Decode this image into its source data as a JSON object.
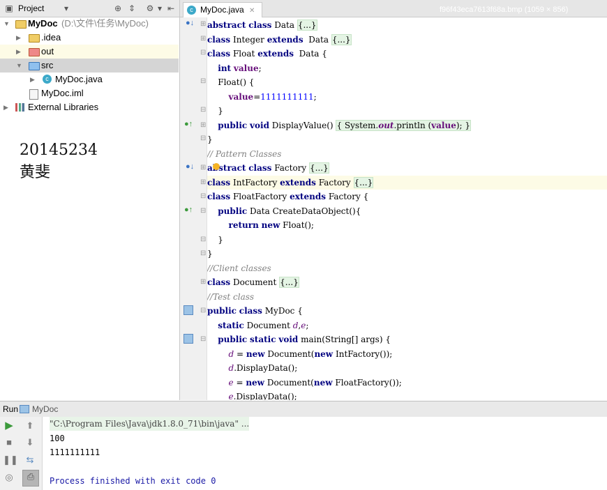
{
  "project": {
    "toolbar_label": "Project",
    "tree": [
      {
        "label": "MyDoc",
        "path": "(D:\\文件\\任务\\MyDoc)"
      },
      {
        "label": ".idea"
      },
      {
        "label": "out"
      },
      {
        "label": "src"
      },
      {
        "label": "MyDoc.java"
      },
      {
        "label": "MyDoc.iml"
      },
      {
        "label": "External Libraries"
      }
    ]
  },
  "note": {
    "line1": "20145234",
    "line2": "黄斐"
  },
  "editor": {
    "tab": "MyDoc.java",
    "tab_shadow": "f96f43eca7613f68a.bmp (1059 × 856)"
  },
  "code": {
    "fold": "{...}",
    "kw_abstract": "abstract",
    "kw_class": "class",
    "kw_extends": "extends",
    "kw_int": "int",
    "kw_public": "public",
    "kw_void": "void",
    "kw_return": "return",
    "kw_new": "new",
    "kw_static": "static",
    "Data": "Data",
    "Integer": "Integer",
    "Float": "Float",
    "value": "value",
    "float_ctor": "Float() {",
    "assign_val": "1111111111",
    "close": "}",
    "display_sig": "DisplayValue()",
    "sysout": "System.",
    "out": "out",
    "println": ".println (",
    "display_end": "); }",
    "cm_pattern": "// Pattern Classes",
    "Factory": "Factory",
    "IntFactory": "IntFactory",
    "FloatFactory": "FloatFactory",
    "create_sig": "Data CreateDataObject(){",
    "float_new": "Float();",
    "cm_client": "//Client classes",
    "Document": "Document",
    "cm_test": "//Test class",
    "MyDoc": "MyDoc {",
    "doc_decl": "Document ",
    "d": "d",
    "e": "e",
    "main_sig": "main(String[] args) {",
    "doc_new": "Document(",
    "intf_new": "IntFactory());",
    "floatf_new": "FloatFactory());",
    "d_display": ".DisplayData();",
    "e_display": ".DisplayData();",
    "brace_open": "{",
    "semi": ";",
    "eq": " = ",
    "comma": ","
  },
  "run": {
    "label": "Run",
    "config": "MyDoc",
    "output": [
      "\"C:\\Program Files\\Java\\jdk1.8.0_71\\bin\\java\" ...",
      "100",
      "1111111111",
      "",
      "Process finished with exit code 0"
    ]
  },
  "colors": {
    "keyword": "#000080",
    "comment": "#808080",
    "number": "#0000ff",
    "field": "#660e7a",
    "run_green": "#3c9a3c"
  }
}
